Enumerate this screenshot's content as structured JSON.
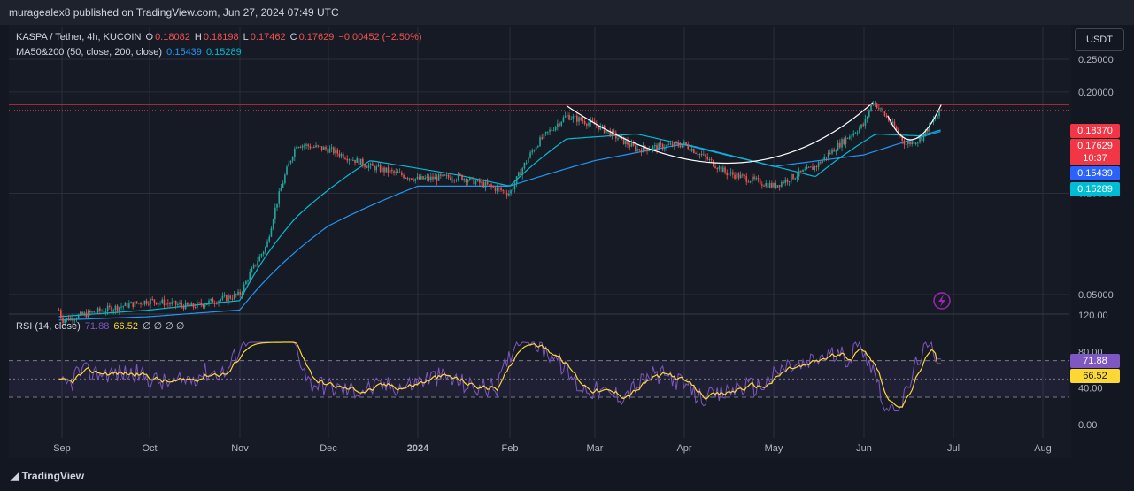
{
  "header": {
    "publisher": "muragealex8 published on TradingView.com, Jun 27, 2024 07:49 UTC"
  },
  "legend": {
    "symbol": "KASPA / Tether, 4h, KUCOIN",
    "o_label": "O",
    "o_value": "0.18082",
    "h_label": "H",
    "h_value": "0.18198",
    "l_label": "L",
    "l_value": "0.17462",
    "c_label": "C",
    "c_value": "0.17629",
    "change": "−0.00452 (−2.50%)",
    "ma_label": "MA50&200 (50, close, 200, close)",
    "ma50_value": "0.15439",
    "ma200_value": "0.15289",
    "rsi_label": "RSI (14, close)",
    "rsi_value": "71.88",
    "rsi_ma_value": "66.52",
    "rsi_extra": "∅ ∅ ∅ ∅"
  },
  "currency": "USDT",
  "badges": {
    "resistance": "0.18370",
    "last_price": "0.17629",
    "countdown": "10:37",
    "ma50": "0.15439",
    "ma200": "0.15289",
    "rsi": "71.88",
    "rsi_ma": "66.52"
  },
  "footer": {
    "brand": "TradingView"
  },
  "colors": {
    "up": "#26a69a",
    "down": "#ef5350",
    "resistance": "#f23645",
    "ma50": "#2196f3",
    "ma200": "#00bcd4",
    "rsi": "#7e57c2",
    "rsi_ma": "#fdd835"
  },
  "chart_data": [
    {
      "type": "line",
      "title": "KASPA / Tether, 4h, KUCOIN",
      "price_ticks": [
        "0.25000",
        "0.20000",
        "0.10000",
        "0.05000"
      ],
      "price_tick_values": [
        0.25,
        0.2,
        0.1,
        0.05
      ],
      "x_ticks": [
        "Sep",
        "Oct",
        "Nov",
        "Dec",
        "2024",
        "Feb",
        "Mar",
        "Apr",
        "May",
        "Jun",
        "Jul",
        "Aug"
      ],
      "series": [
        {
          "name": "KASPA / Tether",
          "points": [
            [
              "Aug 15",
              0.045
            ],
            [
              "Sep 1",
              0.042
            ],
            [
              "Sep 15",
              0.045
            ],
            [
              "Oct 1",
              0.048
            ],
            [
              "Oct 15",
              0.046
            ],
            [
              "Nov 1",
              0.05
            ],
            [
              "Nov 10",
              0.07
            ],
            [
              "Nov 20",
              0.14
            ],
            [
              "Dec 1",
              0.135
            ],
            [
              "Dec 15",
              0.12
            ],
            [
              "Jan 1",
              0.11
            ],
            [
              "Jan 15",
              0.112
            ],
            [
              "Feb 1",
              0.1
            ],
            [
              "Feb 10",
              0.14
            ],
            [
              "Feb 20",
              0.17
            ],
            [
              "Mar 1",
              0.16
            ],
            [
              "Mar 15",
              0.135
            ],
            [
              "Apr 1",
              0.14
            ],
            [
              "Apr 15",
              0.115
            ],
            [
              "May 1",
              0.105
            ],
            [
              "May 15",
              0.12
            ],
            [
              "Jun 1",
              0.16
            ],
            [
              "Jun 4",
              0.188
            ],
            [
              "Jun 15",
              0.14
            ],
            [
              "Jun 20",
              0.145
            ],
            [
              "Jun 27",
              0.17629
            ]
          ]
        },
        {
          "name": "MA50",
          "points": [
            [
              "Aug 15",
              0.043
            ],
            [
              "Oct 1",
              0.045
            ],
            [
              "Nov 1",
              0.048
            ],
            [
              "Nov 20",
              0.085
            ],
            [
              "Dec 15",
              0.125
            ],
            [
              "Jan 15",
              0.113
            ],
            [
              "Feb 1",
              0.105
            ],
            [
              "Feb 20",
              0.145
            ],
            [
              "Mar 15",
              0.15
            ],
            [
              "Apr 15",
              0.13
            ],
            [
              "May 15",
              0.112
            ],
            [
              "Jun 5",
              0.15
            ],
            [
              "Jun 20",
              0.148
            ],
            [
              "Jun 27",
              0.15439
            ]
          ]
        },
        {
          "name": "MA200",
          "points": [
            [
              "Aug 15",
              0.042
            ],
            [
              "Oct 1",
              0.043
            ],
            [
              "Nov 1",
              0.045
            ],
            [
              "Dec 1",
              0.08
            ],
            [
              "Jan 1",
              0.105
            ],
            [
              "Feb 1",
              0.105
            ],
            [
              "Mar 1",
              0.125
            ],
            [
              "Apr 1",
              0.14
            ],
            [
              "May 1",
              0.12
            ],
            [
              "Jun 1",
              0.13
            ],
            [
              "Jun 27",
              0.15289
            ]
          ]
        }
      ],
      "resistance_level": 0.1837,
      "last_price": 0.17629
    },
    {
      "type": "line",
      "title": "RSI (14, close)",
      "y_ticks": [
        "120.00",
        "80.00",
        "40.00",
        "0.00"
      ],
      "y_tick_values": [
        120,
        80,
        40,
        0
      ],
      "bands": [
        70,
        50,
        30
      ],
      "series": [
        {
          "name": "RSI",
          "last": 71.88
        },
        {
          "name": "RSI MA",
          "last": 66.52
        }
      ]
    }
  ]
}
